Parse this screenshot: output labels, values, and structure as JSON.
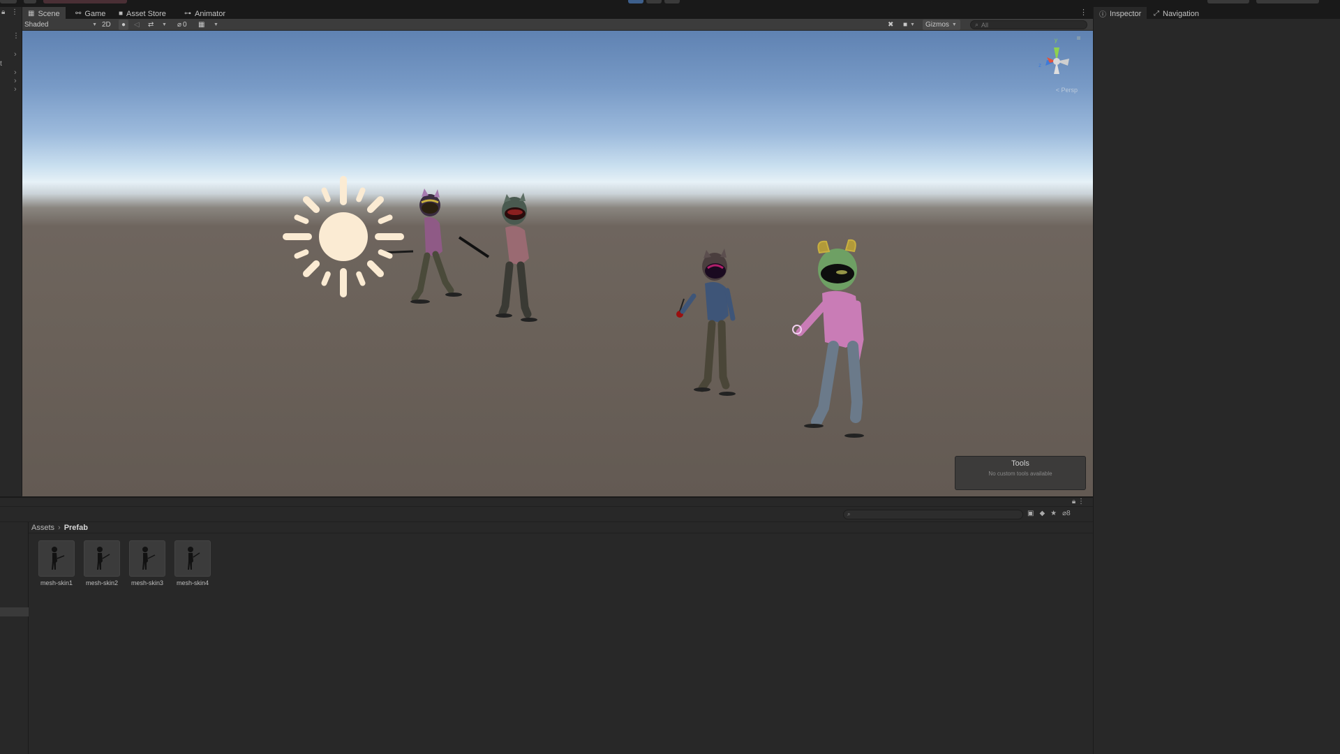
{
  "scene_tabs": [
    {
      "label": "Scene",
      "icon": "grid-icon",
      "active": true
    },
    {
      "label": "Game",
      "icon": "gamepad-icon",
      "active": false
    },
    {
      "label": "Asset Store",
      "icon": "bag-icon",
      "active": false
    },
    {
      "label": "Animator",
      "icon": "animator-icon",
      "active": false
    }
  ],
  "toolbar": {
    "draw_mode": "Shaded",
    "mode_2d": "2D",
    "hidden_count": "0",
    "gizmos": "Gizmos",
    "search_placeholder": "All"
  },
  "viewport": {
    "perspective_label": "< Persp",
    "gizmo_axes": {
      "y": "y",
      "z": "z",
      "x": "x"
    }
  },
  "tools_overlay": {
    "title": "Tools",
    "subtitle": "No custom tools available"
  },
  "inspector_tabs": [
    {
      "label": "Inspector",
      "icon": "info-icon"
    },
    {
      "label": "Navigation",
      "icon": "navigation-icon"
    }
  ],
  "project": {
    "breadcrumb": [
      "Assets",
      "Prefab"
    ],
    "visible_count": "8",
    "assets": [
      {
        "name": "mesh-skin1"
      },
      {
        "name": "mesh-skin2"
      },
      {
        "name": "mesh-skin3"
      },
      {
        "name": "mesh-skin4"
      }
    ]
  },
  "left_hierarchy": {
    "partial_label": "t"
  },
  "colors": {
    "sky_top": "#5f82b2",
    "horizon": "#e6f1f7",
    "ground": "#6b625a",
    "sun": "#fbebd3",
    "panel": "#282828",
    "toolbar": "#3c3c3c"
  }
}
